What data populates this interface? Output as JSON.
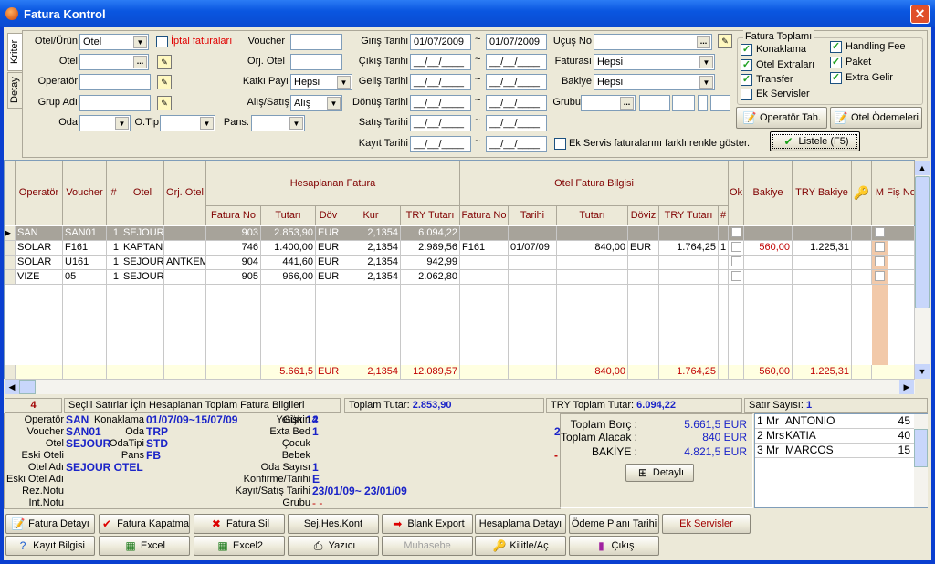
{
  "window": {
    "title": "Fatura Kontrol",
    "close_icon": "close-icon"
  },
  "tabs": [
    "Kriter",
    "Detay"
  ],
  "filters": {
    "otel_urun": {
      "label": "Otel/Ürün",
      "value": "Otel"
    },
    "iptal": {
      "label": "İptal faturaları",
      "checked": false
    },
    "otel": {
      "label": "Otel",
      "value": ""
    },
    "operator": {
      "label": "Operatör",
      "value": ""
    },
    "grup_adi": {
      "label": "Grup Adı",
      "value": ""
    },
    "oda": {
      "label": "Oda",
      "value": ""
    },
    "o_tip": {
      "label": "O.Tip",
      "value": ""
    },
    "pans": {
      "label": "Pans.",
      "value": ""
    },
    "voucher": {
      "label": "Voucher",
      "value": ""
    },
    "orj_otel": {
      "label": "Orj. Otel",
      "value": ""
    },
    "katki_payi": {
      "label": "Katkı Payı",
      "value": "Hepsi"
    },
    "alis_satis": {
      "label": "Alış/Satış",
      "value": "Alış"
    },
    "date_sep": "~",
    "dates": [
      {
        "label": "Giriş Tarihi",
        "from": "01/07/2009",
        "to": "01/07/2009"
      },
      {
        "label": "Çıkış Tarihi",
        "from": "__/__/____",
        "to": "__/__/____"
      },
      {
        "label": "Geliş Tarihi",
        "from": "__/__/____",
        "to": "__/__/____"
      },
      {
        "label": "Dönüş Tarihi",
        "from": "__/__/____",
        "to": "__/__/____"
      },
      {
        "label": "Satış Tarihi",
        "from": "__/__/____",
        "to": "__/__/____"
      },
      {
        "label": "Kayıt Tarihi",
        "from": "__/__/____",
        "to": "__/__/____"
      }
    ],
    "ucus_no": {
      "label": "Uçuş No",
      "value": ""
    },
    "faturasi": {
      "label": "Faturası",
      "value": "Hepsi"
    },
    "bakiye": {
      "label": "Bakiye",
      "value": "Hepsi"
    },
    "grubu": {
      "label": "Grubu",
      "value": ""
    },
    "ek_servis": {
      "label": "Ek Servis faturalarını farklı renkle göster.",
      "checked": false
    }
  },
  "fatura_toplami": {
    "title": "Fatura Toplamı",
    "items": [
      {
        "label": "Konaklama",
        "checked": true
      },
      {
        "label": "Otel Extraları",
        "checked": true
      },
      {
        "label": "Transfer",
        "checked": true
      },
      {
        "label": "Ek Servisler",
        "checked": false
      },
      {
        "label": "Handling Fee",
        "checked": true
      },
      {
        "label": "Paket",
        "checked": true
      },
      {
        "label": "Extra Gelir",
        "checked": true
      }
    ]
  },
  "actions": {
    "operator_tah": "Operatör Tah.",
    "otel_odemeleri": "Otel Ödemeleri",
    "listele": "Listele (F5)"
  },
  "grid": {
    "groups": [
      "Hesaplanan Fatura",
      "Otel Fatura Bilgisi"
    ],
    "columns": [
      "Operatör",
      "Voucher",
      "#",
      "Otel",
      "Orj. Otel",
      "Fatura No",
      "Tutarı",
      "Döv",
      "Kur",
      "TRY Tutarı",
      "Fatura No",
      "Tarihi",
      "Tutarı",
      "Döviz",
      "TRY Tutarı",
      "#",
      "Ok",
      "Bakiye",
      "TRY Bakiye",
      "",
      "M",
      "Fiş No"
    ],
    "rows": [
      [
        "SAN",
        "SAN01",
        "1",
        "SEJOUR",
        "",
        "903",
        "2.853,90",
        "EUR",
        "2,1354",
        "6.094,22",
        "",
        "",
        "",
        "",
        "",
        "",
        false,
        "",
        "",
        "",
        false,
        ""
      ],
      [
        "SOLAR",
        "F161",
        "1",
        "KAPTAN",
        "",
        "746",
        "1.400,00",
        "EUR",
        "2,1354",
        "2.989,56",
        "F161",
        "01/07/09",
        "840,00",
        "EUR",
        "1.764,25",
        "1",
        false,
        "560,00",
        "1.225,31",
        "",
        false,
        ""
      ],
      [
        "SOLAR",
        "U161",
        "1",
        "SEJOUR",
        "ANTKEM",
        "904",
        "441,60",
        "EUR",
        "2,1354",
        "942,99",
        "",
        "",
        "",
        "",
        "",
        "",
        false,
        "",
        "",
        "",
        false,
        ""
      ],
      [
        "VIZE",
        "05",
        "1",
        "SEJOUR",
        "",
        "905",
        "966,00",
        "EUR",
        "2,1354",
        "2.062,80",
        "",
        "",
        "",
        "",
        "",
        "",
        false,
        "",
        "",
        "",
        false,
        ""
      ]
    ],
    "selected_row": 0,
    "footer": [
      "",
      "",
      "",
      "",
      "",
      "",
      "5.661,5",
      "EUR",
      "2,1354",
      "12.089,57",
      "",
      "",
      "840,00",
      "",
      "1.764,25",
      "",
      "",
      "560,00",
      "1.225,31",
      "",
      "",
      ""
    ]
  },
  "status": {
    "count": "4",
    "caption": "Seçili Satırlar İçin Hesaplanan Toplam Fatura Bilgileri",
    "toplam_label": "Toplam Tutar:",
    "toplam_value": "2.853,90",
    "try_label": "TRY Toplam Tutar:",
    "try_value": "6.094,22",
    "satir_label": "Satır Sayısı:",
    "satir_value": "1"
  },
  "detail": {
    "left": [
      {
        "label": "Operatör",
        "value": "SAN"
      },
      {
        "label": "Voucher",
        "value": "SAN01"
      },
      {
        "label": "Otel",
        "value": "SEJOUR"
      },
      {
        "label": "Eski Oteli",
        "value": ""
      },
      {
        "label": "Otel Adı",
        "value": "SEJOUR OTEL"
      },
      {
        "label": "Eski Otel Adı",
        "value": ""
      },
      {
        "label": "Rez.Notu",
        "value": ""
      },
      {
        "label": "Int.Notu",
        "value": ""
      }
    ],
    "middle": [
      {
        "label": "Konaklama",
        "value": "01/07/09~15/07/09"
      },
      {
        "label": "Oda",
        "value": "TRP"
      },
      {
        "label": "OdaTipi",
        "value": "STD"
      },
      {
        "label": "Pans",
        "value": "FB"
      }
    ],
    "gun_label": "Gün",
    "gun_value": "14",
    "right": [
      {
        "label": "Yetişkin",
        "value": "2"
      },
      {
        "label": "Exta Bed",
        "value": "1"
      },
      {
        "label": "Çocuk",
        "value": ""
      },
      {
        "label": "Bebek",
        "value": ""
      },
      {
        "label": "Oda Sayısı",
        "value": "1"
      },
      {
        "label": "Konfirme/Tarihi",
        "value": "E"
      },
      {
        "label": "Kayıt/Satış Tarihi",
        "value": "23/01/09~ 23/01/09"
      },
      {
        "label": "Grubu",
        "value": "-   -"
      }
    ],
    "clipped": [
      "2",
      "-"
    ]
  },
  "totals": {
    "borc_label": "Toplam Borç :",
    "borc": "5.661,5 EUR",
    "alacak_label": "Toplam Alacak :",
    "alacak": "840 EUR",
    "bakiye_label": "BAKİYE :",
    "bakiye": "4.821,5 EUR",
    "detayli": "Detaylı"
  },
  "pax": [
    {
      "no": "1",
      "title": "Mr",
      "name": "ANTONIO",
      "age": "45"
    },
    {
      "no": "2",
      "title": "Mrs",
      "name": "KATIA",
      "age": "40"
    },
    {
      "no": "3",
      "title": "Mr",
      "name": "MARCOS",
      "age": "15"
    }
  ],
  "bottom_buttons": [
    [
      {
        "label": "Fatura Detayı",
        "icon": "notepad-icon"
      },
      {
        "label": "Fatura Kapatma",
        "icon": "checkmark-icon"
      },
      {
        "label": "Fatura Sil",
        "icon": "red-x-icon"
      },
      {
        "label": "Sej.Hes.Kont",
        "icon": ""
      },
      {
        "label": "Blank Export",
        "icon": "export-icon"
      },
      {
        "label": "Hesaplama Detayı",
        "icon": ""
      },
      {
        "label": "Ödeme Planı Tarihi",
        "icon": ""
      },
      {
        "label": "Ek Servisler",
        "icon": ""
      }
    ],
    [
      {
        "label": "Kayıt Bilgisi",
        "icon": "help-icon"
      },
      {
        "label": "Excel",
        "icon": "excel-icon"
      },
      {
        "label": "Excel2",
        "icon": "excel-icon"
      },
      {
        "label": "Yazıcı",
        "icon": "printer-icon"
      },
      {
        "label": "Muhasebe",
        "icon": "",
        "disabled": true
      },
      {
        "label": "Kilitle/Aç",
        "icon": "key-icon"
      },
      {
        "label": "Çıkış",
        "icon": "exit-door-icon"
      }
    ]
  ],
  "colors": {
    "header_text": "#800000",
    "value_blue": "#1a23c8",
    "footer_bg": "#ffffe1",
    "footer_text": "#c00000",
    "selected_row": "#a7a39a",
    "m_column": "#f2c9a9"
  }
}
